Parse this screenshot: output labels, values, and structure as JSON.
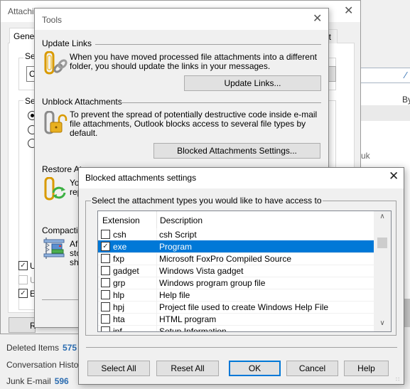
{
  "background": {
    "right_text_by": "By",
    "right_text_uk": "uk",
    "folders": [
      {
        "name": "Deleted Items",
        "count": "575"
      },
      {
        "name": "Conversation Histo",
        "count": ""
      },
      {
        "name": "Junk E-mail",
        "count": "596"
      }
    ]
  },
  "attachment_window": {
    "title": "Attachi",
    "tab_general": "Genera",
    "tab_right": "ut",
    "group1_label": "Sel",
    "combo_value": "C",
    "group2_label": "Sel",
    "radios": [
      {
        "checked": true
      },
      {
        "checked": false
      },
      {
        "checked": false
      }
    ],
    "checkboxes": [
      {
        "label": "U",
        "checked": true,
        "disabled": false
      },
      {
        "label": "U",
        "checked": false,
        "disabled": true
      },
      {
        "label": "E",
        "checked": true,
        "disabled": false
      }
    ],
    "bottom_button": "R"
  },
  "tools_dialog": {
    "title": "Tools",
    "sections": {
      "update_links": {
        "title": "Update Links",
        "desc": "When you have moved processed file attachments into a different folder, you should update the links in your messages.",
        "button": "Update Links..."
      },
      "unblock": {
        "title": "Unblock Attachments",
        "desc": "To prevent the spread of potentially destructive code inside e-mail file attachments, Outlook blocks access to several file types by default.",
        "button": "Blocked Attachments Settings..."
      },
      "restore": {
        "title": "Restore At",
        "desc_line1": "Yo",
        "desc_line2": "rep"
      },
      "compacting": {
        "title": "Compactin",
        "desc_line1": "Af",
        "desc_line2": "sto",
        "desc_line3": "sh"
      }
    }
  },
  "blocked_dialog": {
    "title": "Blocked attachments settings",
    "group_label": "Select the attachment types you would like to have access to",
    "columns": {
      "extension": "Extension",
      "description": "Description"
    },
    "rows": [
      {
        "ext": "csh",
        "desc": "csh Script",
        "checked": false,
        "selected": false
      },
      {
        "ext": "exe",
        "desc": "Program",
        "checked": true,
        "selected": true
      },
      {
        "ext": "fxp",
        "desc": "Microsoft FoxPro Compiled Source",
        "checked": false,
        "selected": false
      },
      {
        "ext": "gadget",
        "desc": "Windows Vista gadget",
        "checked": false,
        "selected": false
      },
      {
        "ext": "grp",
        "desc": "Windows program group file",
        "checked": false,
        "selected": false
      },
      {
        "ext": "hlp",
        "desc": "Help file",
        "checked": false,
        "selected": false
      },
      {
        "ext": "hpj",
        "desc": "Project file used to create Windows Help File",
        "checked": false,
        "selected": false
      },
      {
        "ext": "hta",
        "desc": "HTML program",
        "checked": false,
        "selected": false
      },
      {
        "ext": "inf",
        "desc": "Setup Information",
        "checked": false,
        "selected": false
      }
    ],
    "buttons": {
      "select_all": "Select All",
      "reset_all": "Reset All",
      "ok": "OK",
      "cancel": "Cancel",
      "help": "Help"
    }
  },
  "colors": {
    "selection": "#0078d7",
    "count_blue": "#2b6cb0"
  }
}
